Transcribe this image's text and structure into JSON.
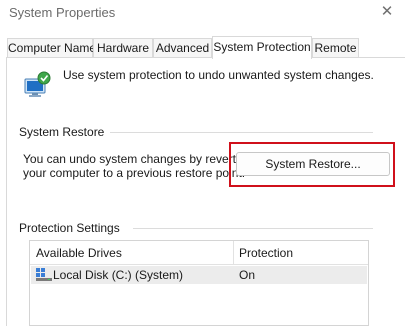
{
  "window": {
    "title": "System Properties",
    "close_glyph": "✕"
  },
  "tabs": [
    {
      "label": "Computer Name",
      "active": false
    },
    {
      "label": "Hardware",
      "active": false
    },
    {
      "label": "Advanced",
      "active": false
    },
    {
      "label": "System Protection",
      "active": true
    },
    {
      "label": "Remote",
      "active": false
    }
  ],
  "intro": {
    "icon": "system-protection-shield-icon",
    "text": "Use system protection to undo unwanted system changes."
  },
  "system_restore": {
    "group_label": "System Restore",
    "description_line1": "You can undo system changes by reverting",
    "description_line2": "your computer to a previous restore point.",
    "button_label": "System Restore...",
    "highlight_color": "#d0101b"
  },
  "protection_settings": {
    "group_label": "Protection Settings",
    "columns": [
      "Available Drives",
      "Protection"
    ],
    "rows": [
      {
        "drive": "Local Disk (C:) (System)",
        "protection": "On",
        "icon": "drive-icon"
      }
    ]
  }
}
